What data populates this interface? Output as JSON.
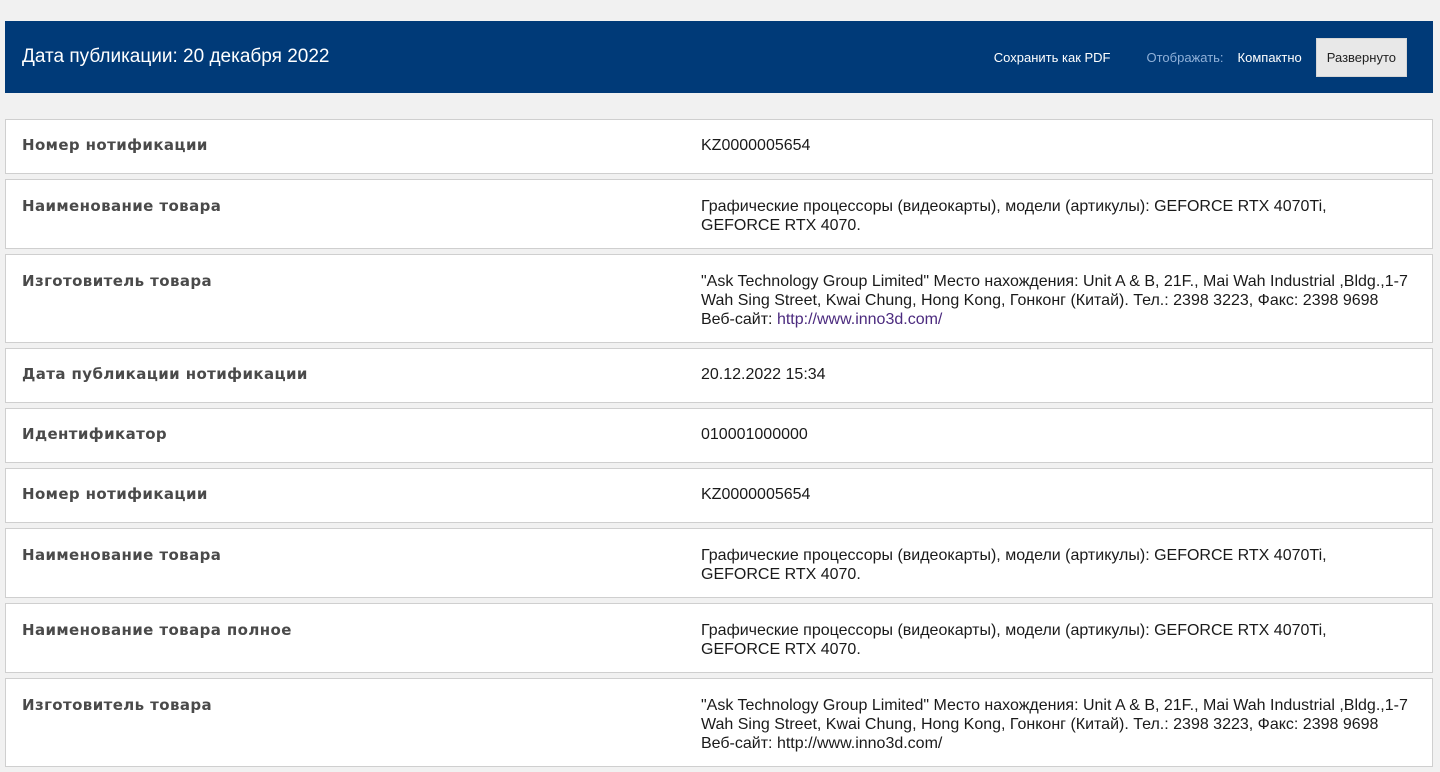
{
  "header": {
    "title": "Дата публикации: 20 декабря 2022",
    "save_pdf": "Сохранить как PDF",
    "display_label": "Отображать:",
    "compact": "Компактно",
    "expanded": "Развернуто"
  },
  "rows": [
    {
      "label": "Номер нотификации",
      "value": "KZ0000005654"
    },
    {
      "label": "Наименование товара",
      "value": "Графические процессоры (видеокарты), модели (артикулы): GEFORCE RTX 4070Ti, GEFORCE RTX 4070."
    },
    {
      "label": "Изготовитель товара",
      "value": "\"Ask Technology Group Limited\" Место нахождения: Unit A & B, 21F., Mai Wah Industrial ,Bldg.,1-7 Wah Sing Street, Kwai Chung, Hong Kong, Гонконг (Китай). Тел.: 2398 3223, Факс: 2398 9698 Веб-сайт:",
      "link": "http://www.inno3d.com/"
    },
    {
      "label": "Дата публикации нотификации",
      "value": "20.12.2022 15:34"
    },
    {
      "label": "Идентификатор",
      "value": "010001000000"
    },
    {
      "label": "Номер нотификации",
      "value": "KZ0000005654"
    },
    {
      "label": "Наименование товара",
      "value": "Графические процессоры (видеокарты), модели (артикулы): GEFORCE RTX 4070Ti, GEFORCE RTX 4070."
    },
    {
      "label": "Наименование товара полное",
      "value": "Графические процессоры (видеокарты), модели (артикулы): GEFORCE RTX 4070Ti, GEFORCE RTX 4070."
    },
    {
      "label": "Изготовитель товара",
      "value": "\"Ask Technology Group Limited\" Место нахождения: Unit A & B, 21F., Mai Wah Industrial ,Bldg.,1-7 Wah Sing Street, Kwai Chung, Hong Kong, Гонконг (Китай). Тел.: 2398 3223, Факс: 2398 9698 Веб-сайт: http://www.inno3d.com/"
    }
  ]
}
